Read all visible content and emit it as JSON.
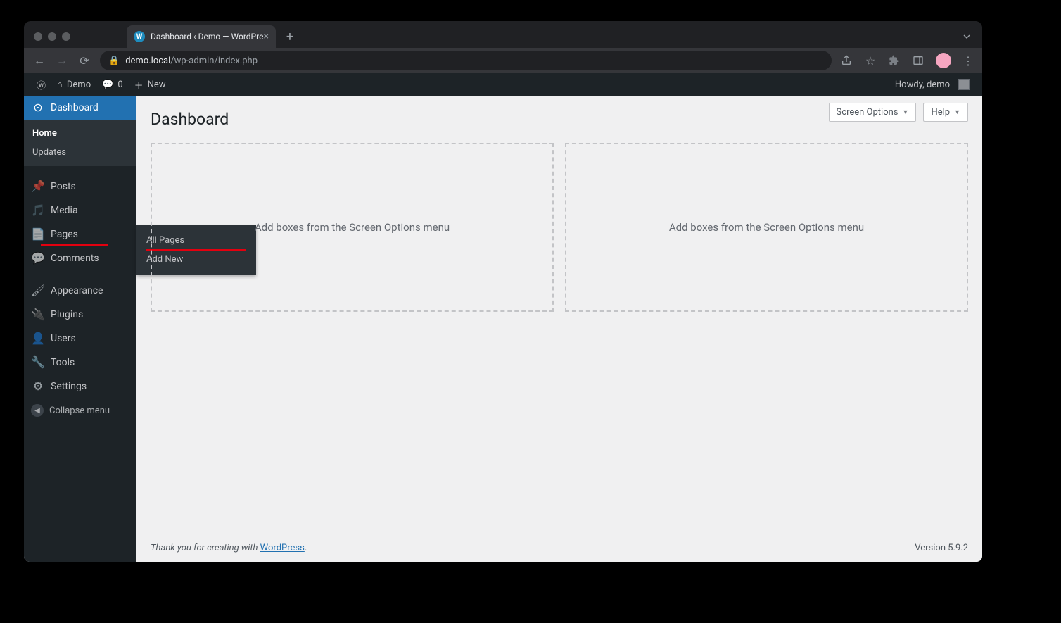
{
  "browser": {
    "tab_title": "Dashboard ‹ Demo — WordPre",
    "url_host": "demo.local",
    "url_path": "/wp-admin/index.php"
  },
  "adminbar": {
    "site_name": "Demo",
    "comments_count": "0",
    "new_label": "New",
    "howdy": "Howdy, demo"
  },
  "menu": {
    "dashboard": "Dashboard",
    "dashboard_sub": {
      "home": "Home",
      "updates": "Updates"
    },
    "posts": "Posts",
    "media": "Media",
    "pages": "Pages",
    "pages_fly": {
      "all": "All Pages",
      "add": "Add New"
    },
    "comments": "Comments",
    "appearance": "Appearance",
    "plugins": "Plugins",
    "users": "Users",
    "tools": "Tools",
    "settings": "Settings",
    "collapse": "Collapse menu"
  },
  "content": {
    "heading": "Dashboard",
    "screen_options": "Screen Options",
    "help": "Help",
    "empty_box": "Add boxes from the Screen Options menu",
    "footer_thank": "Thank you for creating with ",
    "footer_link": "WordPress",
    "footer_dot": ".",
    "version": "Version 5.9.2"
  }
}
